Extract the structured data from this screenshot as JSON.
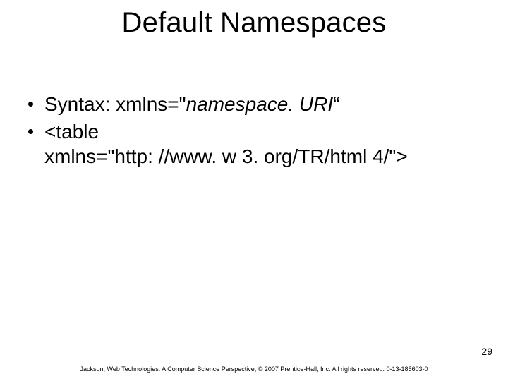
{
  "title": "Default Namespaces",
  "bullets": [
    {
      "prefix": "Syntax: xmlns=\"",
      "italic": "namespace. URI",
      "suffix": "“"
    },
    {
      "line1": "<table",
      "line2": "xmlns=\"http: //www. w 3. org/TR/html 4/\">"
    }
  ],
  "page_number": "29",
  "footer": "Jackson, Web Technologies: A Computer Science Perspective, © 2007 Prentice-Hall, Inc. All rights reserved. 0-13-185603-0"
}
